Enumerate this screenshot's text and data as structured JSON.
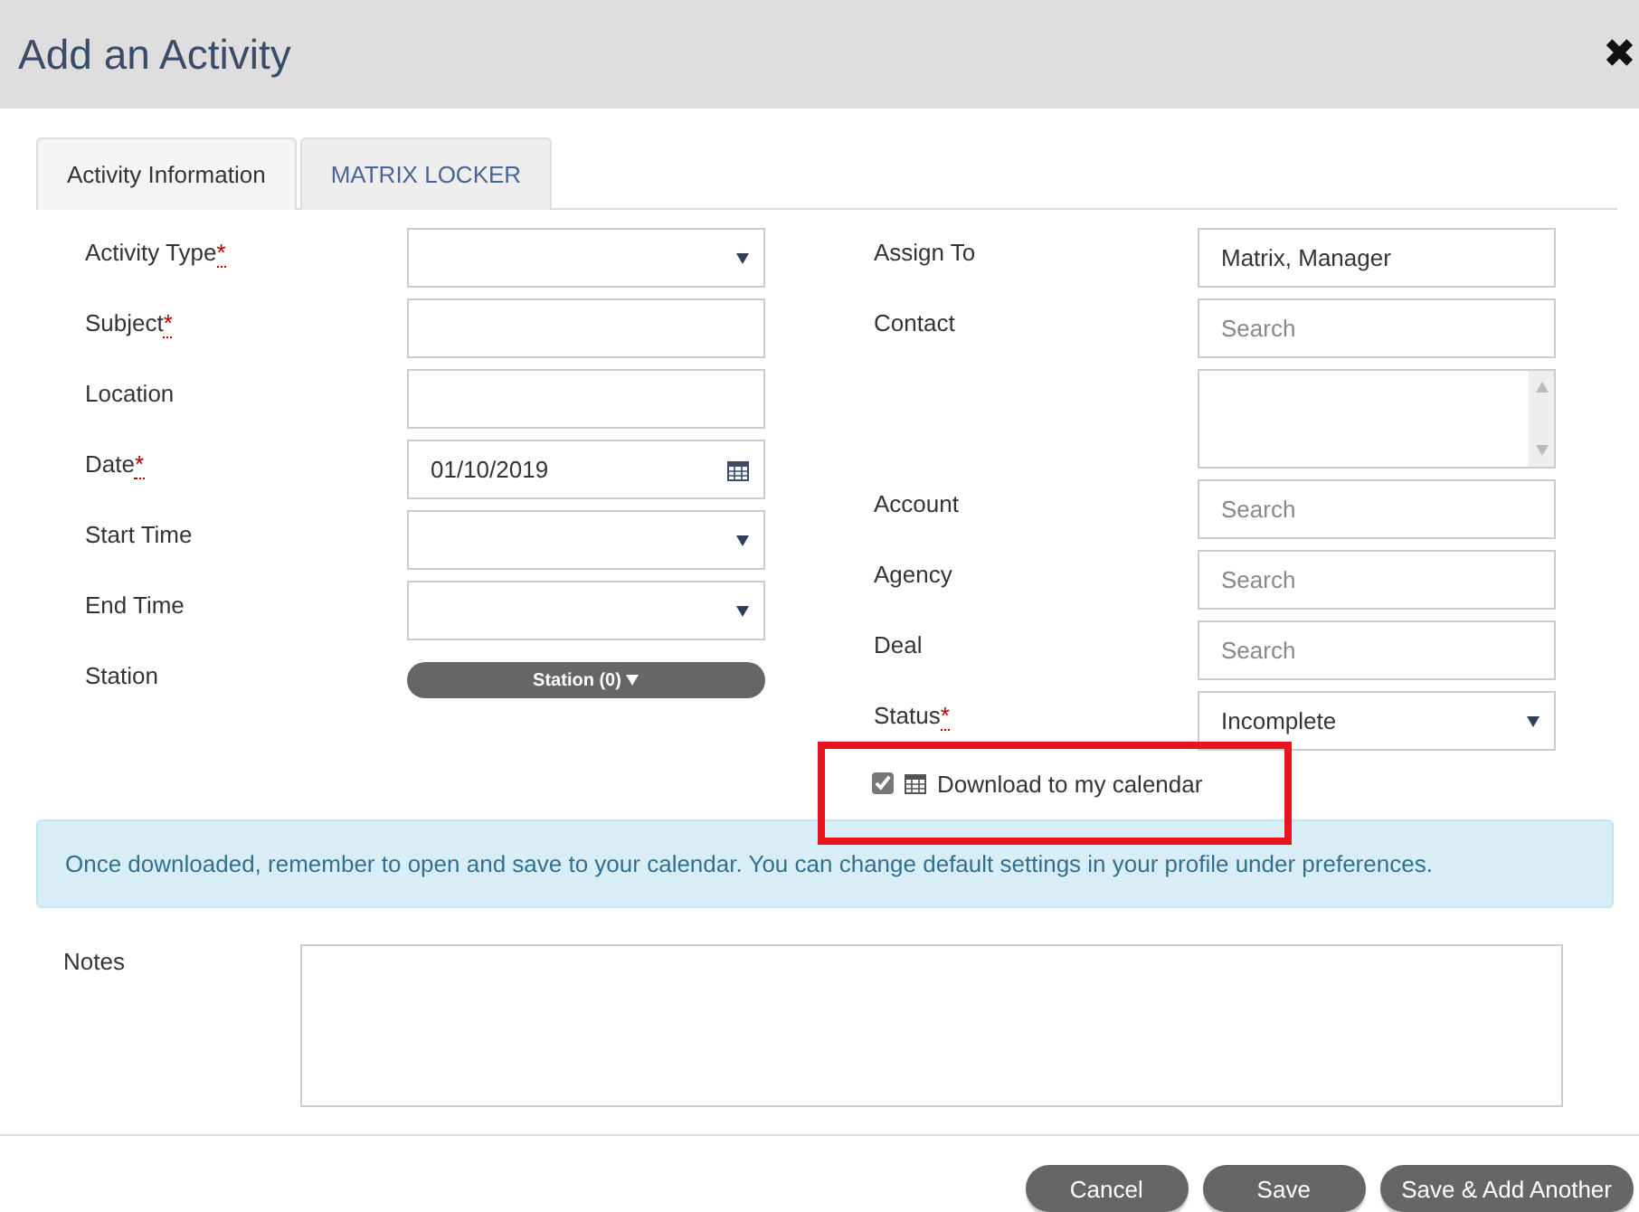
{
  "window": {
    "title": "Add an Activity",
    "close": "✖"
  },
  "tabs": [
    {
      "label": "Activity Information",
      "selected": true
    },
    {
      "label": "MATRIX LOCKER",
      "selected": false
    }
  ],
  "left_fields": [
    {
      "label": "Activity Type",
      "mark": "*",
      "kind": "select"
    },
    {
      "label": "Subject",
      "mark": "*",
      "kind": "text"
    },
    {
      "label": "Location",
      "kind": "text"
    },
    {
      "label": "Date",
      "mark": "*",
      "kind": "date",
      "value": "01/10/2019"
    },
    {
      "label": "Start Time",
      "kind": "select"
    },
    {
      "label": "End Time",
      "kind": "select"
    },
    {
      "label": "Station",
      "kind": "station",
      "value": "Station (0)"
    }
  ],
  "right_fields": [
    {
      "label": "Assign To",
      "kind": "text",
      "value": "Matrix, Manager"
    },
    {
      "label": "Contact",
      "kind": "search",
      "placeholder": "Search"
    },
    {
      "kind": "listbox"
    },
    {
      "label": "Account",
      "kind": "search",
      "placeholder": "Search"
    },
    {
      "label": "Agency",
      "kind": "search",
      "placeholder": "Search"
    },
    {
      "label": "Deal",
      "kind": "search",
      "placeholder": "Search"
    },
    {
      "label": "Status",
      "mark": "*",
      "kind": "select",
      "value": "Incomplete"
    }
  ],
  "download": {
    "label": "Download to my calendar",
    "checked": true,
    "highlighted": true
  },
  "info": "Once downloaded, remember to open and save to your calendar. You can change default settings in your profile under preferences.",
  "notes": {
    "label": "Notes"
  },
  "buttons": [
    "Cancel",
    "Save",
    "Save & Add Another"
  ]
}
